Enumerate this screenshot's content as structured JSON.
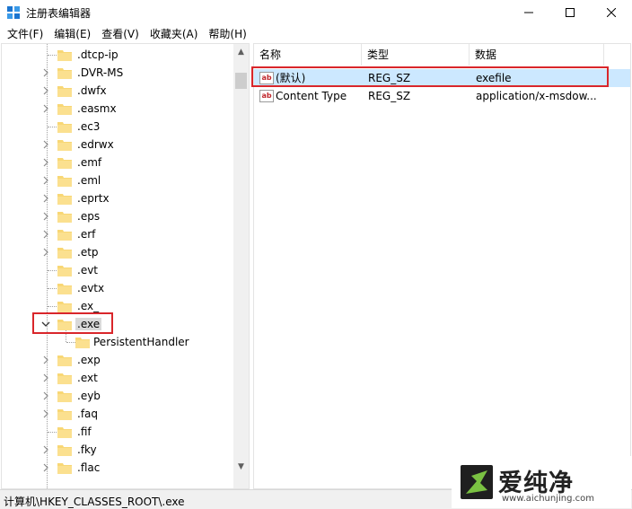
{
  "window": {
    "title": "注册表编辑器",
    "icon": "registry-editor-icon"
  },
  "menu": [
    "文件(F)",
    "编辑(E)",
    "查看(V)",
    "收藏夹(A)",
    "帮助(H)"
  ],
  "tree": {
    "items": [
      {
        "label": ".dtcp-ip",
        "expandable": false
      },
      {
        "label": ".DVR-MS",
        "expandable": true
      },
      {
        "label": ".dwfx",
        "expandable": true
      },
      {
        "label": ".easmx",
        "expandable": true
      },
      {
        "label": ".ec3",
        "expandable": false
      },
      {
        "label": ".edrwx",
        "expandable": true
      },
      {
        "label": ".emf",
        "expandable": true
      },
      {
        "label": ".eml",
        "expandable": true
      },
      {
        "label": ".eprtx",
        "expandable": true
      },
      {
        "label": ".eps",
        "expandable": true
      },
      {
        "label": ".erf",
        "expandable": true
      },
      {
        "label": ".etp",
        "expandable": true
      },
      {
        "label": ".evt",
        "expandable": false
      },
      {
        "label": ".evtx",
        "expandable": false
      },
      {
        "label": ".ex_",
        "expandable": false
      },
      {
        "label": ".exe",
        "expandable": true,
        "expanded": true,
        "selected": true
      },
      {
        "label": "PersistentHandler",
        "child": true
      },
      {
        "label": ".exp",
        "expandable": true
      },
      {
        "label": ".ext",
        "expandable": true
      },
      {
        "label": ".eyb",
        "expandable": true
      },
      {
        "label": ".faq",
        "expandable": true
      },
      {
        "label": ".fif",
        "expandable": false
      },
      {
        "label": ".fky",
        "expandable": true
      },
      {
        "label": ".flac",
        "expandable": true
      }
    ]
  },
  "values": {
    "headers": {
      "name": "名称",
      "type": "类型",
      "data": "数据"
    },
    "rows": [
      {
        "name": "(默认)",
        "type": "REG_SZ",
        "data": "exefile",
        "selected": true
      },
      {
        "name": "Content Type",
        "type": "REG_SZ",
        "data": "application/x-msdow..."
      }
    ]
  },
  "status": {
    "path": "计算机\\HKEY_CLASSES_ROOT\\.exe"
  },
  "watermark": {
    "brand": "爱纯净",
    "url": "www.aichunjing.com"
  },
  "colors": {
    "highlight_red": "#d9262b",
    "selection_blue": "#cce8ff",
    "folder_yellow": "#f8d775"
  }
}
